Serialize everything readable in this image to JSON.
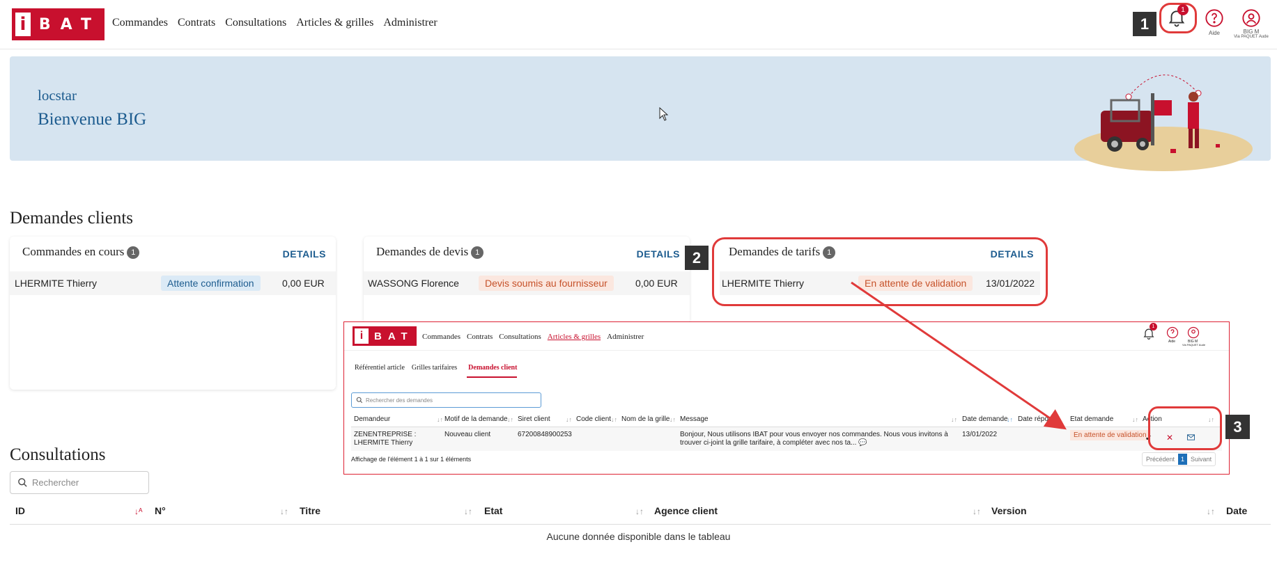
{
  "header": {
    "logo_i": "i",
    "logo_rest": "BAT",
    "nav": [
      "Commandes",
      "Contrats",
      "Consultations",
      "Articles & grilles",
      "Administrer"
    ],
    "notif_count": "1",
    "help_label": "Aide",
    "user_label": "BIG M",
    "user_sub": "Via PAQUET Aude"
  },
  "callouts": [
    "1",
    "2",
    "3"
  ],
  "banner": {
    "company": "locstar",
    "welcome": "Bienvenue BIG"
  },
  "demandes": {
    "title": "Demandes clients",
    "cards": [
      {
        "title": "Commandes en cours",
        "count": "1",
        "details": "DETAILS",
        "name": "LHERMITE Thierry",
        "status": "Attente confirmation",
        "value": "0,00 EUR"
      },
      {
        "title": "Demandes de devis",
        "count": "1",
        "details": "DETAILS",
        "name": "WASSONG Florence",
        "status": "Devis soumis au fournisseur",
        "value": "0,00 EUR"
      },
      {
        "title": "Demandes de tarifs",
        "count": "1",
        "details": "DETAILS",
        "name": "LHERMITE Thierry",
        "status": "En attente de validation",
        "value": "13/01/2022"
      }
    ]
  },
  "inset": {
    "nav": [
      "Commandes",
      "Contrats",
      "Consultations",
      "Articles & grilles",
      "Administrer"
    ],
    "notif_count": "1",
    "help_label": "Aide",
    "user_label": "BIG M",
    "user_sub": "Via PAQUET Aude",
    "tabs": [
      "Référentiel article",
      "Grilles tarifaires",
      "Demandes client"
    ],
    "search_placeholder": "Rechercher des demandes",
    "columns": [
      "Demandeur",
      "Motif de la demande",
      "Siret client",
      "Code client",
      "Nom de la grille",
      "Message",
      "Date demande",
      "Date réponse",
      "Etat demande",
      "Action"
    ],
    "row": {
      "demandeur_1": "ZENENTREPRISE :",
      "demandeur_2": "LHERMITE Thierry",
      "motif": "Nouveau client",
      "siret": "67200848900253",
      "message_1": "Bonjour, Nous utilisons IBAT pour vous envoyer nos commandes. Nous vous invitons à",
      "message_2": "trouver ci-joint la grille tarifaire, à compléter avec nos ta...",
      "date": "13/01/2022",
      "etat": "En attente de validation"
    },
    "footer": "Affichage de l'élément 1 à 1 sur 1 éléments",
    "pager": {
      "prev": "Précédent",
      "page": "1",
      "next": "Suivant"
    }
  },
  "consultations": {
    "title": "Consultations",
    "search_placeholder": "Rechercher",
    "columns": [
      "ID",
      "N°",
      "Titre",
      "Etat",
      "Agence client",
      "Version",
      "Date"
    ],
    "empty": "Aucune donnée disponible dans le tableau"
  },
  "colors": {
    "brand": "#c8102e",
    "link": "#1d5c8f",
    "banner": "#d6e4f0",
    "annotation": "#e03a3a"
  }
}
